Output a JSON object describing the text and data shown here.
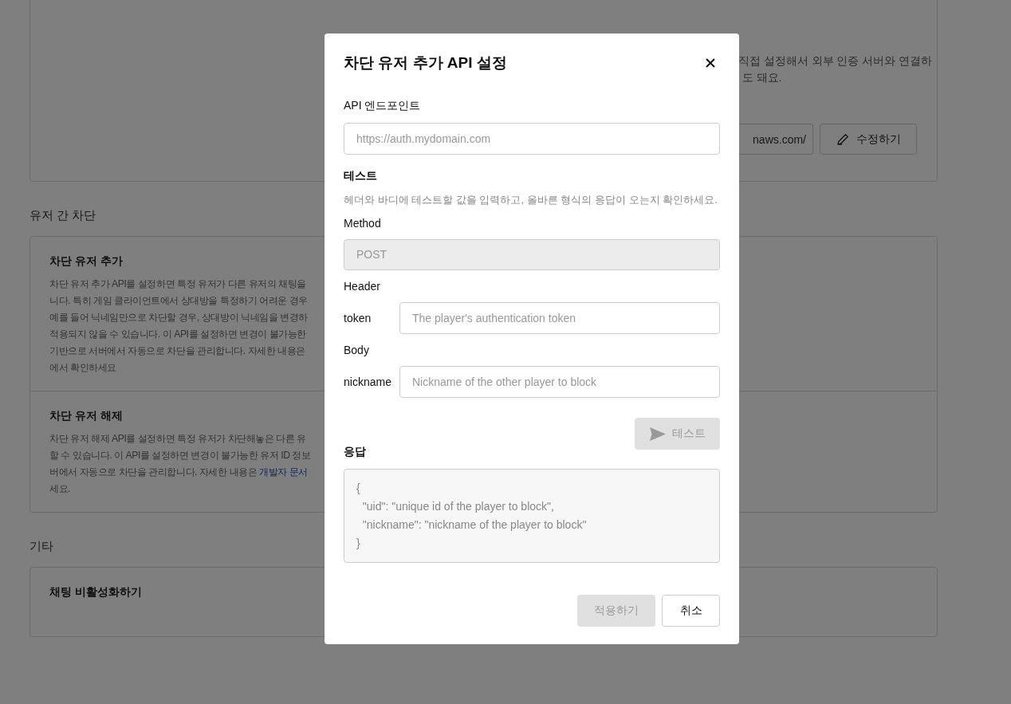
{
  "background": {
    "auth_card": {
      "description_lines": [
        "직접 설정해서 외부 인증 서버와 연결하",
        "도 돼요."
      ],
      "url_value": "naws.com/",
      "edit_button": "수정하기"
    },
    "sections": [
      {
        "title": "유저 간 차단",
        "items": [
          {
            "title": "차단 유저 추가",
            "lines": [
              {
                "text": "차단 유저 추가 API를 설정하면 특정 유저가 다른 유저의 채팅을"
              },
              {
                "text": "니다. 특히 게임 클라이언트에서 상대방을 특정하기 어려운 경우"
              },
              {
                "text": "예를 들어 닉네임만으로 차단할 경우, 상대방이 닉네임을 변경하"
              },
              {
                "text": "적용되지 않을 수 있습니다. 이 API를 설정하면 변경이 불가능한"
              },
              {
                "text": "기반으로 서버에서 자동으로 차단을 관리합니다. 자세한 내용은"
              },
              {
                "text": "에서 확인하세요"
              }
            ]
          },
          {
            "title": "차단 유저 해제",
            "lines": [
              {
                "text": "차단 유저 해제 API를 설정하면 특정 유저가 차단해놓은 다른 유"
              },
              {
                "text": "할 수 있습니다. 이 API를 설정하면 변경이 불가능한 유저 ID 정보"
              },
              {
                "text": "버에서 자동으로 차단을 관리합니다. 자세한 내용은 ",
                "link": "개발자 문서"
              },
              {
                "text": "세요."
              }
            ]
          }
        ]
      },
      {
        "title": "기타",
        "items": [
          {
            "title": "채팅 비활성화하기"
          }
        ]
      }
    ]
  },
  "modal": {
    "title": "차단 유저 추가 API 설정",
    "endpoint": {
      "label": "API 엔드포인트",
      "placeholder": "https://auth.mydomain.com"
    },
    "test": {
      "title": "테스트",
      "description": "헤더와 바디에 테스트할 값을 입력하고, 올바른 형식의 응답이 오는지 확인하세요.",
      "method": {
        "label": "Method",
        "value": "POST",
        "disabled": true
      },
      "groups": [
        {
          "label": "Header",
          "params": [
            {
              "name": "token",
              "placeholder": "The player's authentication token"
            }
          ]
        },
        {
          "label": "Body",
          "params": [
            {
              "name": "nickname",
              "placeholder": "Nickname of the other player to block"
            }
          ]
        }
      ],
      "test_button": {
        "label": "테스트",
        "disabled": true
      }
    },
    "response": {
      "label": "응답",
      "text": "{\n  \"uid\": \"unique id of the player to block\",\n  \"nickname\": \"nickname of the player to block\"\n}"
    },
    "buttons": [
      {
        "label": "적용하기",
        "kind": "primary",
        "disabled": true
      },
      {
        "label": "취소",
        "kind": "secondary",
        "disabled": false
      }
    ]
  }
}
